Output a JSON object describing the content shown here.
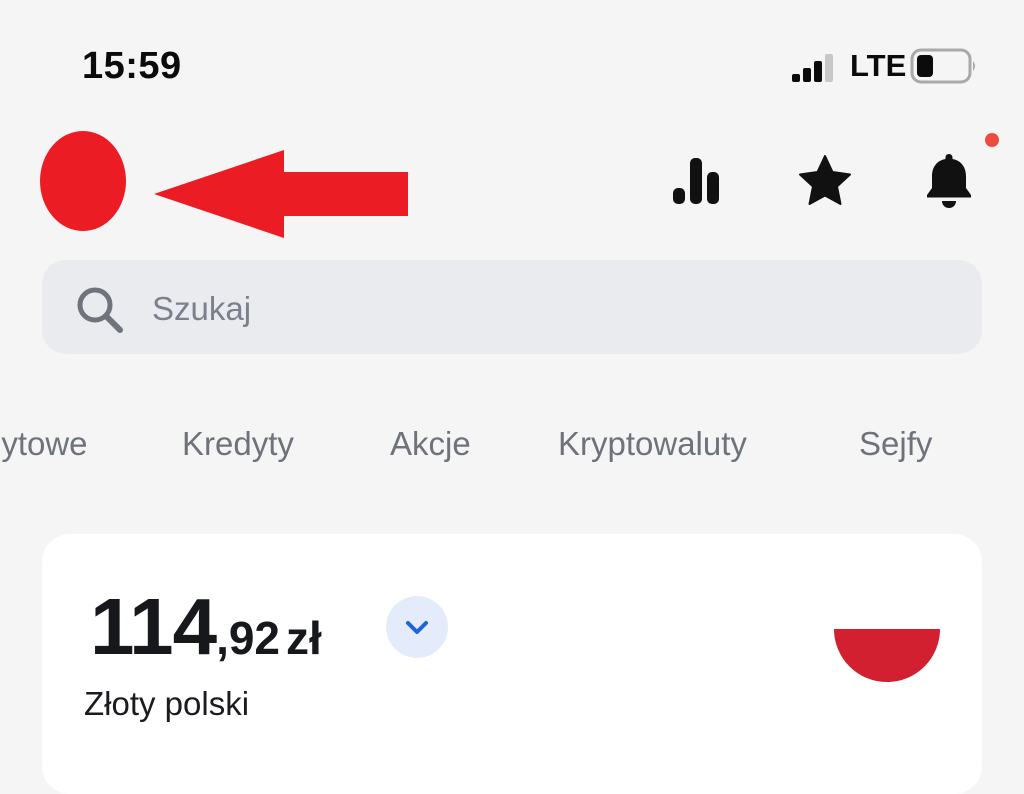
{
  "status_bar": {
    "time": "15:59",
    "network": "LTE",
    "signal_bars_active": 3,
    "signal_bars_total": 4,
    "battery_level": 0.25
  },
  "header": {
    "avatar_color": "#ec1c24",
    "annotation_arrow_color": "#ec1c24",
    "icons": [
      "stats-icon",
      "star-icon",
      "bell-icon"
    ],
    "notification_dot_color": "#ef4b3f"
  },
  "search": {
    "placeholder": "Szukaj",
    "icon": "search-icon"
  },
  "tabs": [
    {
      "label": "lytowe"
    },
    {
      "label": "Kredyty"
    },
    {
      "label": "Akcje"
    },
    {
      "label": "Kryptowaluty"
    },
    {
      "label": "Sejfy"
    }
  ],
  "account": {
    "balance_int": "114",
    "balance_frac": ",92",
    "currency_symbol": "zł",
    "currency_name": "Złoty polski",
    "expand_icon": "chevron-down-icon",
    "flag": "poland-flag",
    "flag_red": "#d22030",
    "accent_color": "#1f63d6"
  }
}
